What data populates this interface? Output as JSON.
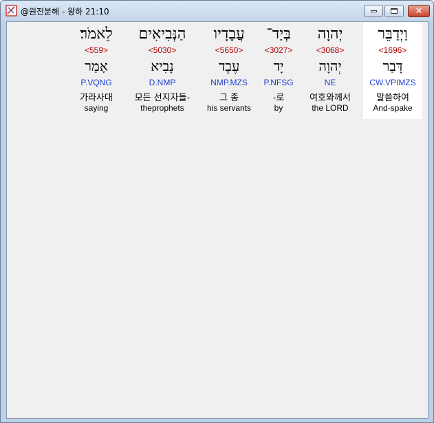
{
  "window": {
    "title": "@원전분해 - 왕하 21:10"
  },
  "colors": {
    "strong": "#b00000",
    "morph": "#1f3fd0",
    "selected_bg": "#ffffff"
  },
  "words": [
    {
      "hebrew": "וַיְדַבֵּר",
      "strong": "<1696>",
      "lemma": "דָּבַר",
      "morph": "CW.VPIMZS",
      "korean": "말씀하여",
      "english": "And-spake",
      "selected": true
    },
    {
      "hebrew": "יְהוָה",
      "strong": "<3068>",
      "lemma": "יְהוָה",
      "morph": "NE",
      "korean": "여호와께서",
      "english": "the LORD",
      "selected": false
    },
    {
      "hebrew": "בְּיַד־",
      "strong": "<3027>",
      "lemma": "יָד",
      "morph": "P.NFSG",
      "korean": "-로",
      "english": "by",
      "selected": false
    },
    {
      "hebrew": "עֲבָדָיו",
      "strong": "<5650>",
      "lemma": "עֶבֶד",
      "morph": "NMP.MZS",
      "korean": "그 종",
      "english": "his servants",
      "selected": false
    },
    {
      "hebrew": "הַנְּבִיאִים",
      "strong": "<5030>",
      "lemma": "נָבִיא",
      "morph": "D.NMP",
      "korean": "모든 선지자들-",
      "english": "theprophets",
      "selected": false
    },
    {
      "hebrew": "לֵאמֹר׃",
      "strong": "<559>",
      "lemma": "אָמַר",
      "morph": "P.VQNG",
      "korean": "가라사대",
      "english": "saying",
      "selected": false
    }
  ]
}
